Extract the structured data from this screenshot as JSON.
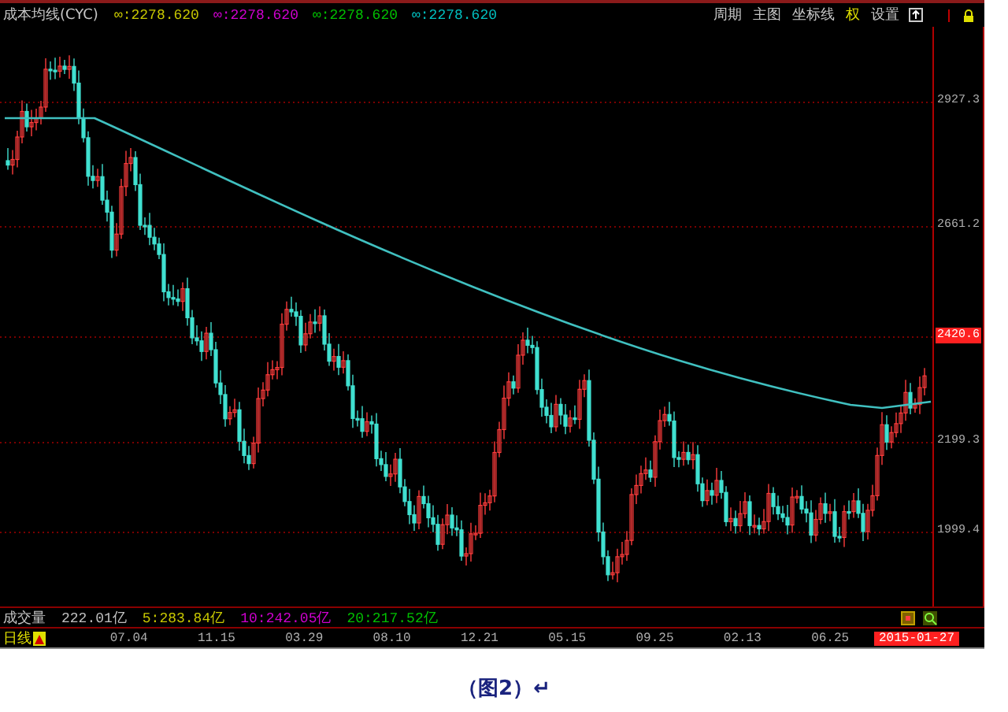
{
  "header": {
    "title": "成本均线(CYC)",
    "legend": [
      {
        "text": "∞:2278.620",
        "color": "#c8c800"
      },
      {
        "text": "∞:2278.620",
        "color": "#d000d0"
      },
      {
        "text": "∞:2278.620",
        "color": "#00c000"
      },
      {
        "text": "∞:2278.620",
        "color": "#00c0c0"
      }
    ],
    "toolbar": [
      {
        "label": "周期",
        "highlighted": false
      },
      {
        "label": "主图",
        "highlighted": false
      },
      {
        "label": "坐标线",
        "highlighted": false
      },
      {
        "label": "权",
        "highlighted": true
      },
      {
        "label": "设置",
        "highlighted": false
      }
    ]
  },
  "y_axis": [
    {
      "label": "2927.3",
      "current": false
    },
    {
      "label": "2661.2",
      "current": false
    },
    {
      "label": "2420.6",
      "current": true
    },
    {
      "label": "2199.3",
      "current": false
    },
    {
      "label": "1999.4",
      "current": false
    }
  ],
  "volume": {
    "title": "成交量",
    "items": [
      {
        "text": "222.01亿",
        "color": "#c0c0c0"
      },
      {
        "text": "5:283.84亿",
        "color": "#c8c800"
      },
      {
        "text": "10:242.05亿",
        "color": "#d000d0"
      },
      {
        "text": "20:217.52亿",
        "color": "#00c000"
      }
    ]
  },
  "x_axis": {
    "period": "日线",
    "dates": [
      "07.04",
      "11.15",
      "03.29",
      "08.10",
      "12.21",
      "05.15",
      "09.25",
      "02.13",
      "06.25"
    ],
    "current": "2015-01-27"
  },
  "caption": "（图**2**）↵"
}
